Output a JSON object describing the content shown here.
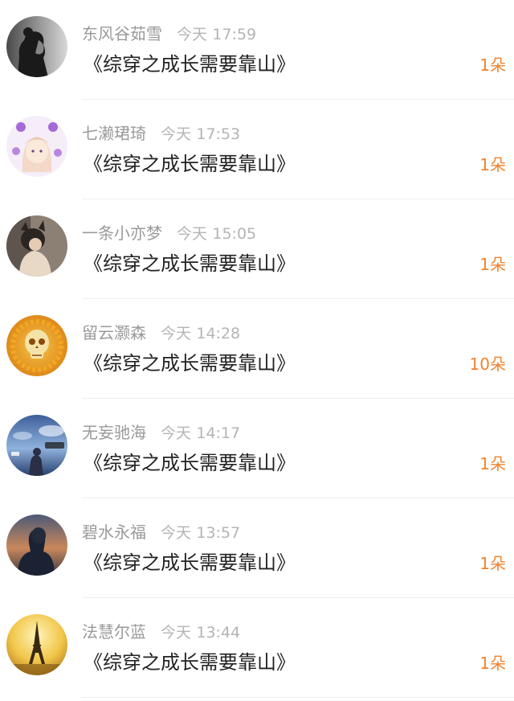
{
  "gifts": [
    {
      "name": "东风谷茹雪",
      "day": "今天",
      "time": "17:59",
      "title": "《综穿之成长需要靠山》",
      "amount": "1朵",
      "avatar": "avatar-dark-profile"
    },
    {
      "name": "七濑珺琦",
      "day": "今天",
      "time": "17:53",
      "title": "《综穿之成长需要靠山》",
      "amount": "1朵",
      "avatar": "avatar-anime-purple"
    },
    {
      "name": "一条小亦梦",
      "day": "今天",
      "time": "15:05",
      "title": "《综穿之成长需要靠山》",
      "amount": "1朵",
      "avatar": "avatar-cat-ears-girl"
    },
    {
      "name": "留云灏森",
      "day": "今天",
      "time": "14:28",
      "title": "《综穿之成长需要靠山》",
      "amount": "10朵",
      "avatar": "avatar-golden-skull"
    },
    {
      "name": "无妄驰海",
      "day": "今天",
      "time": "14:17",
      "title": "《综穿之成长需要靠山》",
      "amount": "1朵",
      "avatar": "avatar-girl-sky"
    },
    {
      "name": "碧水永福",
      "day": "今天",
      "time": "13:57",
      "title": "《综穿之成长需要靠山》",
      "amount": "1朵",
      "avatar": "avatar-man-sunset"
    },
    {
      "name": "法慧尔蓝",
      "day": "今天",
      "time": "13:44",
      "title": "《综穿之成长需要靠山》",
      "amount": "1朵",
      "avatar": "avatar-eiffel-tower"
    }
  ]
}
